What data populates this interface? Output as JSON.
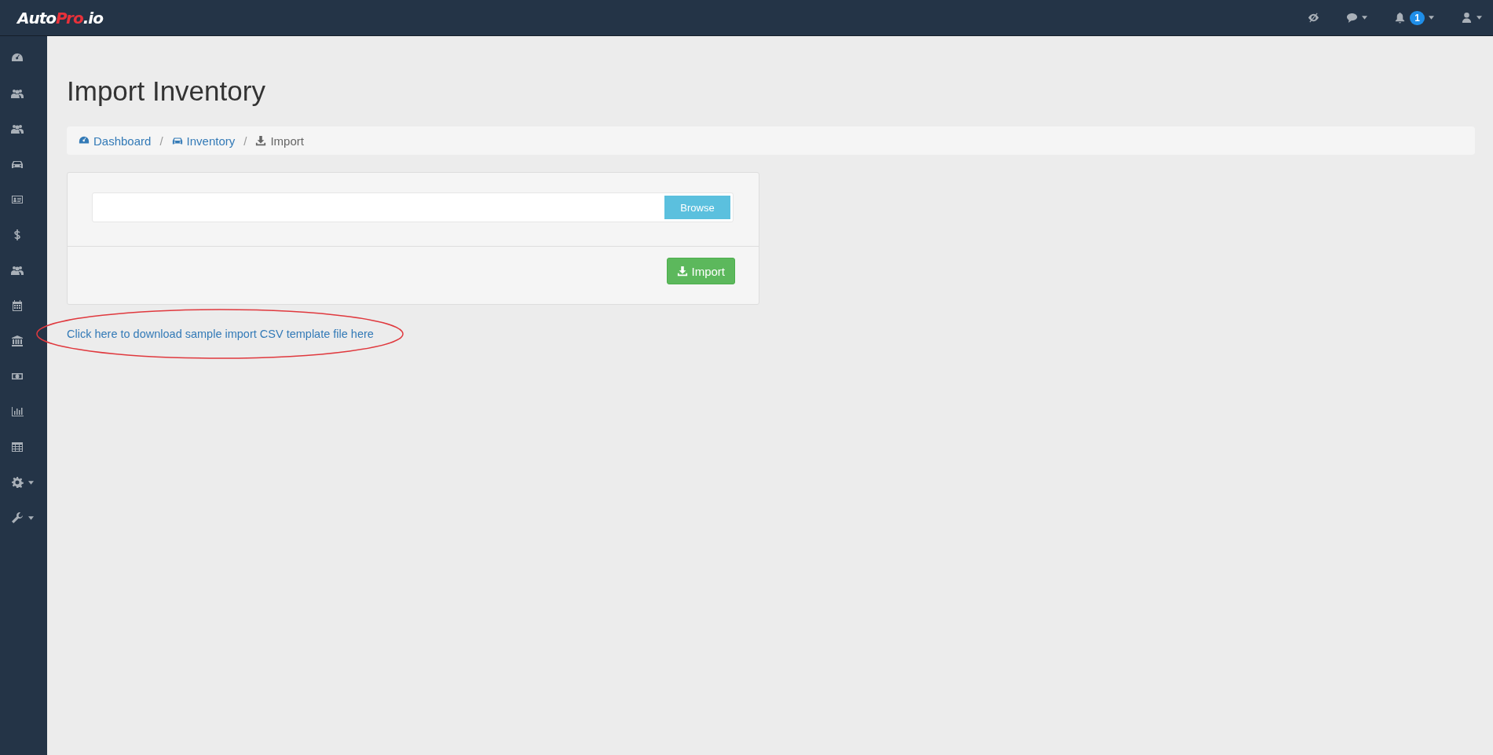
{
  "topbar": {
    "logo": [
      {
        "text": "Auto",
        "accent": false
      },
      {
        "text": "Pro",
        "accent": true
      },
      {
        "text": ".io",
        "accent": false
      }
    ],
    "icons": [
      {
        "kind": "eye-slash",
        "caret": false
      },
      {
        "kind": "comment",
        "caret": true
      },
      {
        "kind": "bell",
        "caret": true,
        "badge": "1"
      },
      {
        "kind": "user",
        "caret": true
      }
    ]
  },
  "sidebar": {
    "items": [
      {
        "kind": "gauge",
        "caret": false
      },
      {
        "kind": "users",
        "caret": false
      },
      {
        "kind": "users",
        "caret": false
      },
      {
        "kind": "car",
        "caret": false
      },
      {
        "kind": "card",
        "caret": false
      },
      {
        "kind": "dollar",
        "caret": false
      },
      {
        "kind": "users",
        "caret": false
      },
      {
        "kind": "calendar",
        "caret": false
      },
      {
        "kind": "bank",
        "caret": false
      },
      {
        "kind": "money",
        "caret": false
      },
      {
        "kind": "chart",
        "caret": false
      },
      {
        "kind": "table",
        "caret": false
      },
      {
        "kind": "gear",
        "caret": true
      },
      {
        "kind": "wrench",
        "caret": true
      }
    ]
  },
  "page": {
    "title": "Import Inventory",
    "breadcrumb": [
      {
        "label": "Dashboard",
        "kind": "gauge",
        "link": true
      },
      {
        "label": "Inventory",
        "kind": "car",
        "link": true,
        "separator": "/"
      },
      {
        "label": "Import",
        "kind": "download",
        "link": false,
        "separator": "/"
      }
    ],
    "upload": {
      "browse_label": "Browse",
      "import_label": "Import"
    },
    "template_link": "Click here to download sample import CSV template file here",
    "annotation": {
      "kind": "ellipse"
    }
  }
}
